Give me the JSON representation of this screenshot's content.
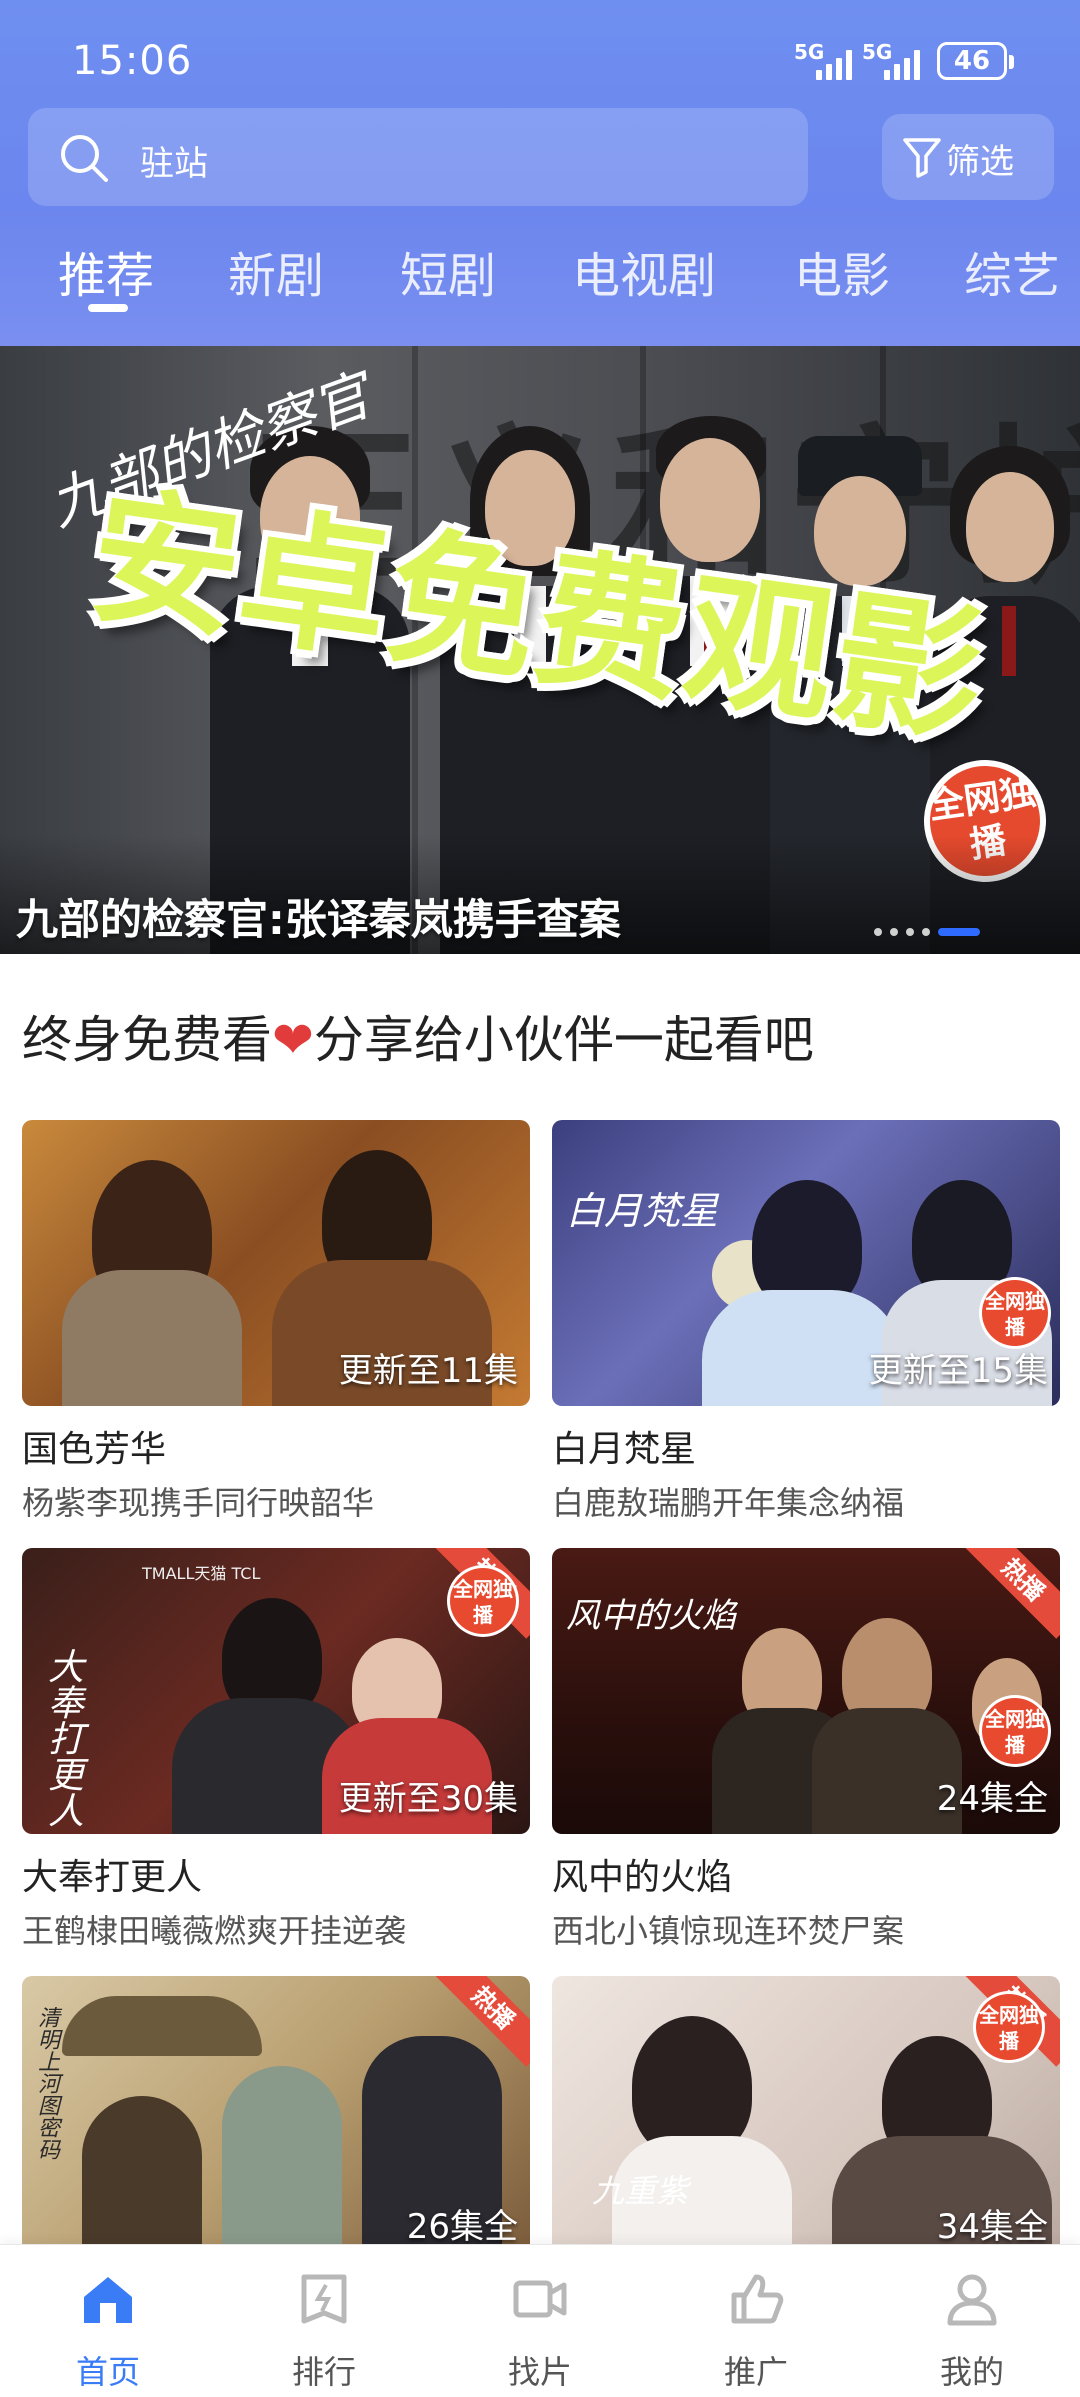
{
  "status_bar": {
    "time": "15:06",
    "network": [
      "5G",
      "5G"
    ],
    "battery": "46"
  },
  "search": {
    "text": "驻站",
    "filter_label": "筛选"
  },
  "tabs": [
    {
      "label": "推荐",
      "active": true
    },
    {
      "label": "新剧"
    },
    {
      "label": "短剧"
    },
    {
      "label": "电视剧"
    },
    {
      "label": "电影"
    },
    {
      "label": "综艺"
    }
  ],
  "banner": {
    "wall_text": "正义和守护",
    "script_logo": "九部的检察官",
    "overlay": "安卓免费观影",
    "badge": "全网独播",
    "caption": "九部的检察官:张译秦岚携手查案",
    "dot_count": 5,
    "active_dot": 4
  },
  "promo": {
    "before": "终身免费看",
    "heart": "❤",
    "after": "分享给小伙伴一起看吧"
  },
  "cards": [
    {
      "title": "国色芳华",
      "subtitle": "杨紫李现携手同行映韶华",
      "episodes": "更新至11集"
    },
    {
      "title": "白月梵星",
      "subtitle": "白鹿敖瑞鹏开年集念纳福",
      "episodes": "更新至15集",
      "logo": "白月梵星",
      "seal": "全网独播"
    },
    {
      "title": "大奉打更人",
      "subtitle": "王鹤棣田曦薇燃爽开挂逆袭",
      "episodes": "更新至30集",
      "logo": "大奉打更人",
      "hot": "热播",
      "seal": "全网独播",
      "sponsors": "TMALL天猫  TCL"
    },
    {
      "title": "风中的火焰",
      "subtitle": "西北小镇惊现连环焚尸案",
      "episodes": "24集全",
      "logo": "风中的火焰",
      "hot": "热播",
      "seal": "全网独播"
    },
    {
      "title": "",
      "subtitle": "",
      "episodes": "26集全",
      "logo": "清明上河图密码",
      "hot": "热播"
    },
    {
      "title": "",
      "subtitle": "",
      "episodes": "34集全",
      "logo": "九重紫",
      "hot": "热播",
      "seal": "全网独播"
    }
  ],
  "bottom_nav": [
    {
      "label": "首页",
      "icon": "home-icon",
      "active": true
    },
    {
      "label": "排行",
      "icon": "ranking-icon"
    },
    {
      "label": "找片",
      "icon": "video-camera-icon"
    },
    {
      "label": "推广",
      "icon": "thumbs-up-icon"
    },
    {
      "label": "我的",
      "icon": "user-icon"
    }
  ],
  "colors": {
    "header": "#6f8ff0",
    "accent": "#3a7bf6",
    "overlay_text": "#dcf65a",
    "hot": "#e54b3a"
  }
}
